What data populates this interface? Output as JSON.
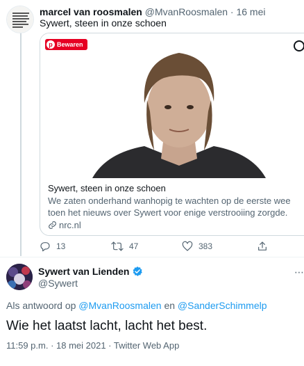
{
  "parent_tweet": {
    "name": "marcel van roosmalen",
    "handle": "@MvanRoosmalen",
    "separator": "·",
    "date": "16 mei",
    "text": "Sywert, steen in onze schoen",
    "card": {
      "pin_button": "Bewaren",
      "title": "Sywert, steen in onze schoen",
      "description": "We zaten onderhand wanhopig te wachten op de eerste wee toen het nieuws over Sywert voor enige verstrooiing zorgde. Goed nieuws, want...",
      "domain": "nrc.nl"
    },
    "actions": {
      "replies": "13",
      "retweets": "47",
      "likes": "383"
    }
  },
  "main_tweet": {
    "name": "Sywert van Lienden",
    "handle": "@Sywert",
    "reply_prefix": "Als antwoord op",
    "reply_user_1": "@MvanRoosmalen",
    "reply_conj": "en",
    "reply_user_2": "@SanderSchimmelp",
    "text": "Wie het laatst lacht, lacht het best.",
    "timestamp": "11:59 p.m. · 18 mei 2021 · Twitter Web App"
  },
  "colors": {
    "accent": "#1d9bf0",
    "secondary_text": "#536471",
    "border": "#cfd9de",
    "pinterest": "#e60023"
  }
}
